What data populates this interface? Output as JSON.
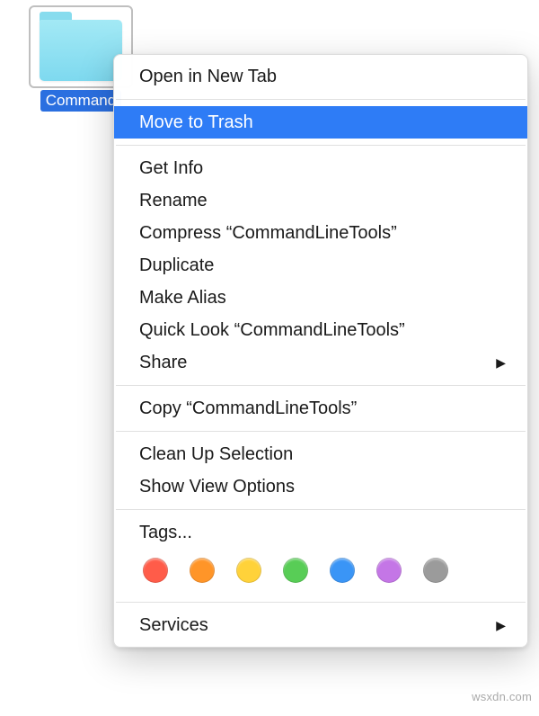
{
  "folder": {
    "label": "Command"
  },
  "menu": {
    "open_new_tab": "Open in New Tab",
    "move_to_trash": "Move to Trash",
    "get_info": "Get Info",
    "rename": "Rename",
    "compress": "Compress “CommandLineTools”",
    "duplicate": "Duplicate",
    "make_alias": "Make Alias",
    "quick_look": "Quick Look “CommandLineTools”",
    "share": "Share",
    "copy": "Copy “CommandLineTools”",
    "clean_up": "Clean Up Selection",
    "show_view_options": "Show View Options",
    "tags": "Tags...",
    "services": "Services"
  },
  "tag_colors": {
    "red": "#ff5c49",
    "orange": "#ff9528",
    "yellow": "#ffd23a",
    "green": "#58cd56",
    "blue": "#3a95f6",
    "purple": "#c476e6",
    "gray": "#9b9b9b"
  },
  "watermark": "wsxdn.com"
}
